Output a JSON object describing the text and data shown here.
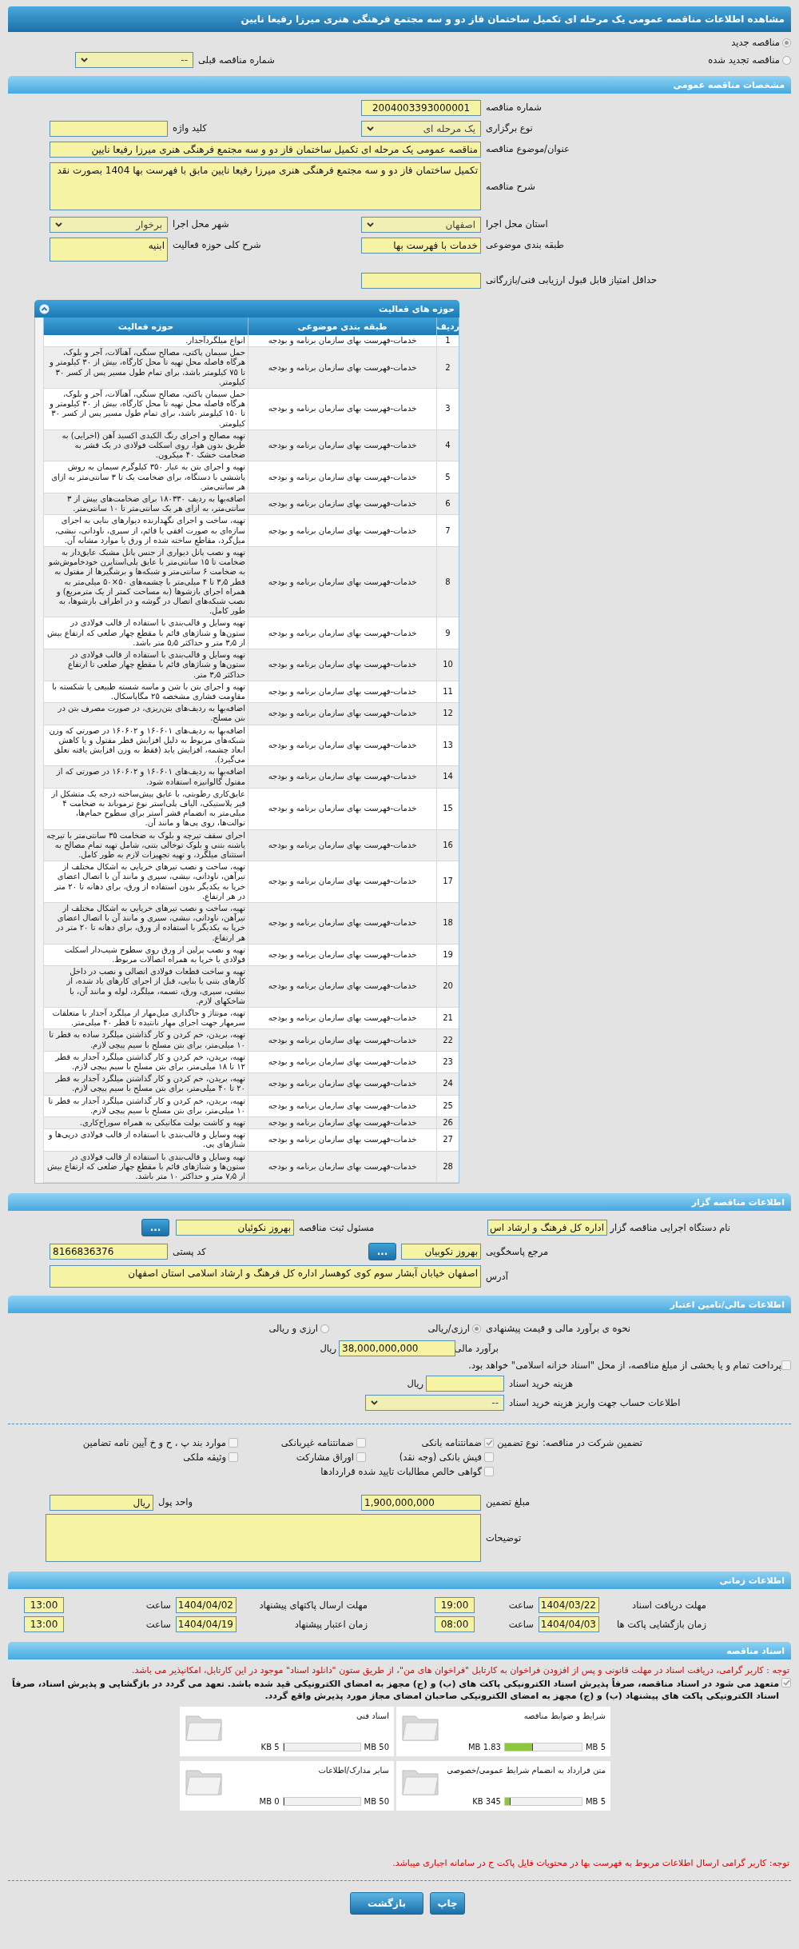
{
  "page_title": "مشاهده اطلاعات مناقصه عمومی یک مرحله ای تکمیل ساختمان فاز دو و سه مجتمع فرهنگی هنری میرزا رفیعا نایین",
  "tender_type": [
    {
      "label": "مناقصه جدید",
      "selected": true
    },
    {
      "label": "مناقصه تجدید شده",
      "selected": false
    }
  ],
  "previous_tender": {
    "label": "شماره مناقصه قبلی",
    "value": "--"
  },
  "general": {
    "title": "مشخصات مناقصه عمومی",
    "tender_number": {
      "label": "شماره مناقصه",
      "value": "2004003393000001"
    },
    "holding_type": {
      "label": "نوع برگزاری",
      "value": "یک مرحله ای"
    },
    "keyword": {
      "label": "کلید واژه"
    },
    "subject": {
      "label": "عنوان/موضوع مناقصه",
      "value": "مناقصه عمومی یک مرحله ای تکمیل ساختمان فاز دو و سه  مجتمع فرهنگی هنری میرزا رفیعا نایین"
    },
    "description": {
      "label": "شرح مناقصه",
      "value": "تکمیل ساختمان فاز دو و سه  مجتمع فرهنگی هنری میرزا رفیعا نایین مابق با فهرست بها 1404 بصورت نقد"
    },
    "province": {
      "label": "استان محل اجرا",
      "value": "اصفهان"
    },
    "city": {
      "label": "شهر محل اجرا",
      "value": "برخوار"
    },
    "category": {
      "label": "طبقه بندی موضوعی",
      "value": "خدمات با فهرست بها"
    },
    "activity_summary": {
      "label": "شرح کلی حوزه فعالیت",
      "value": "ابنیه"
    },
    "min_score": {
      "label": "حداقل امتیاز قابل قبول ارزیابی فنی/بازرگانی"
    }
  },
  "activities": {
    "title": "حوزه های فعالیت",
    "columns": [
      "ردیف",
      "طبقه بندی موضوعی",
      "حوزه فعالیت"
    ],
    "rows": [
      {
        "number": "1",
        "category": "خدمات-فهرست بهای سازمان برنامه و بودجه",
        "scope": "انواع میلگردآجدار."
      },
      {
        "number": "2",
        "category": "خدمات-فهرست بهای سازمان برنامه و بودجه",
        "scope": "حمل سیمان پاکتی، مصالح سنگی، آهنآلات، آجر و بلوک، هرگاه فاصله محل تهیه تا محل کارگاه، بیش از ۳۰ کیلومتر و تا ۷۵ کیلومتر باشد، برای تمام طول مسیر پس از کسر ۳۰ کیلومتر."
      },
      {
        "number": "3",
        "category": "خدمات-فهرست بهای سازمان برنامه و بودجه",
        "scope": "حمل سیمان پاکتی، مصالح سنگی، آهنآلات، آجر و بلوک، هرگاه فاصله محل تهیه تا محل کارگاه، بیش از ۳۰ کیلومتر و تا ۱۵۰ کیلومتر باشد، برای تمام طول مسیر پس از کسر ۳۰ کیلومتر."
      },
      {
        "number": "4",
        "category": "خدمات-فهرست بهای سازمان برنامه و بودجه",
        "scope": "تهیه مصالح و اجرای رنگ الکیدی اکسید آهن (اخرایی) به طریق بدون هوا، روی اسکلت فولادی در یک قشر به ضخامت خشک ۴۰ میکرون."
      },
      {
        "number": "5",
        "category": "خدمات-فهرست بهای سازمان برنامه و بودجه",
        "scope": "تهیه و اجرای بتن به عیار ۳۵۰ کیلوگرم سیمان به روش پاششی با دستگاه، برای ضخامت یک تا ۳ سانتی‌متر به ازای هر سانتی‌متر."
      },
      {
        "number": "6",
        "category": "خدمات-فهرست بهای سازمان برنامه و بودجه",
        "scope": "اضافه‌بها به ردیف ۱۸۰۳۳۰ برای ضخامت‌های بیش از ۳ سانتی‌متر، به ازای هر یک سانتی‌متر تا ۱۰ سانتی‌متر."
      },
      {
        "number": "7",
        "category": "خدمات-فهرست بهای سازمان برنامه و بودجه",
        "scope": "تهیه، ساخت و اجرای نگهدارنده دیوارهای بنایی به اجزای سازه‌ای به صورت افقی یا قائم، از سپری، ناودانی، نبشی، میل‌گرد، مقاطع ساخته شده از ورق یا موارد مشابه آن."
      },
      {
        "number": "8",
        "category": "خدمات-فهرست بهای سازمان برنامه و بودجه",
        "scope": "تهیه و نصب پانل دیواری از جنس پانل مشبک عایق‌دار به ضخامت تا ۱۵ سانتی‌متر با عایق پلی‌استایرن خودخاموش‌شو به ضخامت ۶ سانتی‌متر و شبکه‌ها و برشگیرها از مفتول به قطر ۳٫۵ تا ۴ میلی‌متر با چشمه‌های ۵۰×۵۰ میلی‌متر به همراه اجرای بازشوها (به مساحت کمتر از یک مترمربع) و نصب شبکه‌های اتصال در گوشه و در اطراف بازشوها، به طور کامل."
      },
      {
        "number": "9",
        "category": "خدمات-فهرست بهای سازمان برنامه و بودجه",
        "scope": "تهیه وسایل و قالب‌بندی با استفاده از قالب فولادی در ستون‌ها و شناژهای قائم با مقطع چهار ضلعی که ارتفاع بیش از ۳٫۵ متر و حداکثر ۵٫۵ متر باشد."
      },
      {
        "number": "10",
        "category": "خدمات-فهرست بهای سازمان برنامه و بودجه",
        "scope": "تهیه وسایل و قالب‌بندی با استفاده از قالب فولادی در ستون‌ها و شناژهای قائم با مقطع چهار ضلعی تا ارتفاع حداکثر ۳٫۵ متر."
      },
      {
        "number": "11",
        "category": "خدمات-فهرست بهای سازمان برنامه و بودجه",
        "scope": "تهیه و اجرای بتن با شن و ماسه شسته طبیعی یا شکسته با مقاومت فشاری مشخصه ۲۵ مگاپاسکال."
      },
      {
        "number": "12",
        "category": "خدمات-فهرست بهای سازمان برنامه و بودجه",
        "scope": "اضافه‌بها به ردیف‌های بتن‌ریزی، در صورت مصرف بتن در بتن مسلح."
      },
      {
        "number": "13",
        "category": "خدمات-فهرست بهای سازمان برنامه و بودجه",
        "scope": "اضافه‌بها به ردیف‌های ۱۶۰۶۰۱ و ۱۶۰۶۰۲ در صورتی که وزن شبکه‌های مربوط به دلیل افزایش قطر مفتول و یا کاهش ابعاد چشمه، افزایش یابد (فقط به وزن افزایش یافته تعلق می‌گیرد)."
      },
      {
        "number": "14",
        "category": "خدمات-فهرست بهای سازمان برنامه و بودجه",
        "scope": "اضافه‌بها به ردیف‌های ۱۶۰۶۰۱ و ۱۶۰۶۰۲ در صورتی که از مفتول گالوانیزه استفاده شود."
      },
      {
        "number": "15",
        "category": "خدمات-فهرست بهای سازمان برنامه و بودجه",
        "scope": "عایق‌کاری رطوبتی، با عایق پیش‌ساخته درجه یک متشکل از قیر پلاستیکی، الیاف پلی‌استر نوع ترموباند به ضخامت ۴ میلی‌متر به انضمام قشر آستر برای سطوح حمام‌ها، توالت‌ها، روی پی‌ها و مانند آن."
      },
      {
        "number": "16",
        "category": "خدمات-فهرست بهای سازمان برنامه و بودجه",
        "scope": "اجرای سقف تیرچه و بلوک به ضخامت ۳۵ سانتی‌متر با تیرچه پاشنه بتنی و بلوک توخالی بتنی، شامل تهیه تمام مصالح به استثنای میلگرد، و تهیه تجهیزات لازم به طور کامل."
      },
      {
        "number": "17",
        "category": "خدمات-فهرست بهای سازمان برنامه و بودجه",
        "scope": "تهیه، ساخت و نصب تیرهای خرپایی به اشکال مختلف از تیرآهن، ناودانی، نبشی، سپری و مانند آن با اتصال اعضای خرپا به یکدیگر بدون استفاده از ورق، برای دهانه تا ۲۰ متر در هر ارتفاع."
      },
      {
        "number": "18",
        "category": "خدمات-فهرست بهای سازمان برنامه و بودجه",
        "scope": "تهیه، ساخت و نصب تیرهای خرپایی به اشکال مختلف از تیرآهن، ناودانی، نبشی، سپری و مانند آن با اتصال اعضای خرپا به یکدیگر با استفاده از ورق، برای دهانه تا ۲۰ متر در هر ارتفاع."
      },
      {
        "number": "19",
        "category": "خدمات-فهرست بهای سازمان برنامه و بودجه",
        "scope": "تهیه و نصب پرلین از ورق روی سطوح شیب‌دار اسکلت فولادی یا خرپا به همراه اتصالات مربوط."
      },
      {
        "number": "20",
        "category": "خدمات-فهرست بهای سازمان برنامه و بودجه",
        "scope": "تهیه و ساخت قطعات فولادی اتصالی و نصب در داخل کارهای بتنی یا بنایی، قبل از اجرای کارهای یاد شده، از نبشی، سپری، ورق، تسمه، میلگرد، لوله و مانند آن، با شاخکهای لازم."
      },
      {
        "number": "21",
        "category": "خدمات-فهرست بهای سازمان برنامه و بودجه",
        "scope": "تهیه، مونتاژ و جاگذاری میل‌مهار از میلگرد آجدار با متعلقات سرمهار جهت اجرای مهار نانتیده تا قطر ۴۰ میلی‌متر."
      },
      {
        "number": "22",
        "category": "خدمات-فهرست بهای سازمان برنامه و بودجه",
        "scope": "تهیه، بریدن، خم کردن و کار گذاشتن میلگرد ساده به قطر تا ۱۰ میلی‌متر، برای بتن مسلح با سیم پیچی لازم."
      },
      {
        "number": "23",
        "category": "خدمات-فهرست بهای سازمان برنامه و بودجه",
        "scope": "تهیه، بریدن، خم کردن و کار گذاشتن میلگرد آجدار به قطر ۱۲ تا ۱۸ میلی‌متر، برای بتن مسلح با سیم پیچی لازم."
      },
      {
        "number": "24",
        "category": "خدمات-فهرست بهای سازمان برنامه و بودجه",
        "scope": "تهیه، بریدن، خم کردن و کار گذاشتن میلگرد آجدار به قطر ۲۰ تا ۴۰ میلی‌متر، برای بتن مسلح با سیم پیچی لازم."
      },
      {
        "number": "25",
        "category": "خدمات-فهرست بهای سازمان برنامه و بودجه",
        "scope": "تهیه، بریدن، خم کردن و کار گذاشتن میلگرد آجدار به قطر تا ۱۰ میلی‌متر، برای بتن مسلح با سیم پیچی لازم."
      },
      {
        "number": "26",
        "category": "خدمات-فهرست بهای سازمان برنامه و بودجه",
        "scope": "تهیه و کاشت بولت مکانیکی به همراه سوراخ‌کاری."
      },
      {
        "number": "27",
        "category": "خدمات-فهرست بهای سازمان برنامه و بودجه",
        "scope": "تهیه وسایل و قالب‌بندی با استفاده از قالب فولادی درپی‌ها و شناژهای پی."
      },
      {
        "number": "28",
        "category": "خدمات-فهرست بهای سازمان برنامه و بودجه",
        "scope": "تهیه وسایل و قالب‌بندی با استفاده از قالب فولادی در ستون‌ها و شناژهای قائم با مقطع چهار ضلعی که ارتفاع بیش از ۷٫۵ متر و حداکثر ۱۰ متر باشد."
      }
    ]
  },
  "organizer": {
    "title": "اطلاعات مناقصه گزار",
    "org_name": {
      "label": "نام دستگاه اجرایی مناقصه گزار",
      "value": "اداره کل فرهنگ و ارشاد اس"
    },
    "registrar": {
      "label": "مسئول ثبت مناقصه",
      "value": "بهروز نکوئیان",
      "button": "..."
    },
    "contact": {
      "label": "مرجع پاسخگویی",
      "value": "بهروز نکوبیان",
      "button": "..."
    },
    "postal_code": {
      "label": "کد پستی",
      "value": "8166836376"
    },
    "address": {
      "label": "آدرس",
      "value": "اصفهان خیابان آبشار سوم کوی کوهسار اداره کل فرهنگ و ارشاد اسلامی استان اصفهان"
    }
  },
  "finance": {
    "title": "اطلاعات مالی/تامین اعتبار",
    "estimate_method": {
      "label": "نحوه ی برآورد مالی و قیمت پیشنهادی",
      "options": [
        {
          "label": "ارزی/ریالی",
          "selected": true
        },
        {
          "label": "ارزی و ریالی",
          "selected": false
        }
      ]
    },
    "estimate": {
      "label": "برآورد مالی",
      "value": "38,000,000,000",
      "unit": "ریال"
    },
    "treasury": {
      "label": "پرداخت تمام و یا بخشی از مبلغ مناقصه، از محل \"اسناد خزانه اسلامی\" خواهد بود.",
      "checked": false
    },
    "doc_fee": {
      "label": "هزینه خرید اسناد",
      "unit": "ریال"
    },
    "account": {
      "label": "اطلاعات حساب جهت واریز هزینه خرید اسناد",
      "value": "--"
    },
    "guarantee": {
      "label": "تضمین شرکت در مناقصه:",
      "type_label": "نوع تضمین",
      "options": [
        {
          "label": "ضمانتنامه بانکی",
          "checked": true
        },
        {
          "label": "ضمانتنامه غیربانکی",
          "checked": false
        },
        {
          "label": "موارد بند پ ، ح و خ آیین نامه تضامین",
          "checked": false
        },
        {
          "label": "فیش بانکی (وجه نقد)",
          "checked": false
        },
        {
          "label": "اوراق مشارکت",
          "checked": false
        },
        {
          "label": "وثیقه ملکی",
          "checked": false
        },
        {
          "label": "گواهی خالص مطالبات تایید شده قراردادها",
          "checked": false
        }
      ]
    },
    "amount": {
      "label": "مبلغ تضمین",
      "value": "1,900,000,000"
    },
    "currency": {
      "label": "واحد پول",
      "value": "ریال"
    },
    "notes": {
      "label": "توضیحات"
    }
  },
  "timing": {
    "title": "اطلاعات زمانی",
    "items": [
      {
        "label": "مهلت دریافت اسناد",
        "date": "1404/03/22",
        "time_label": "ساعت",
        "time": "19:00"
      },
      {
        "label": "مهلت ارسال پاکتهای پیشنهاد",
        "date": "1404/04/02",
        "time_label": "ساعت",
        "time": "13:00"
      },
      {
        "label": "زمان بازگشایی پاکت ها",
        "date": "1404/04/03",
        "time_label": "ساعت",
        "time": "08:00"
      },
      {
        "label": "زمان اعتبار پیشنهاد",
        "date": "1404/04/19",
        "time_label": "ساعت",
        "time": "13:00"
      }
    ]
  },
  "documents": {
    "title": "اسناد مناقصه",
    "notice": "توجه : کاربر گرامی، دریافت اسناد در مهلت قانونی و پس از افزودن فراخوان به کارتابل \"فراخوان های من\"، از طریق ستون \"دانلود اسناد\" موجود در این کارتابل، امکانپذیر می باشد.",
    "commitment": {
      "text": "متعهد می شود در اسناد مناقصه، صرفاً پذیرش اسناد الکترونیکی پاکت های (ب) و (ج) مجهز به امضای الکترونیکی قید شده باشد. تعهد می گردد در بازگشایی و پذیرش اسناد، صرفاً اسناد الکترونیکی پاکت های پیشنهاد (ب) و (ج) مجهز به امضای الکترونیکی صاحبان امضای مجاز مورد پذیرش واقع گردد.",
      "checked": true
    },
    "files": [
      {
        "name": "شرایط و ضوابط مناقصه",
        "size": "1.83 MB",
        "max": "5 MB",
        "level": 0.37
      },
      {
        "name": "اسناد فنی",
        "size": "5 KB",
        "max": "50 MB",
        "level": 0.01
      },
      {
        "name": "متن قرارداد به انضمام شرایط عمومی/خصوصی",
        "size": "345 KB",
        "max": "5 MB",
        "level": 0.07
      },
      {
        "name": "سایر مدارک/اطلاعات",
        "size": "0 MB",
        "max": "50 MB",
        "level": 0
      }
    ],
    "notice2": "توجه: کاربر گرامی ارسال اطلاعات مربوط به فهرست بها در محتویات فایل پاکت ج در سامانه اجباری میباشد."
  },
  "buttons": [
    "چاپ",
    "بازگشت"
  ]
}
